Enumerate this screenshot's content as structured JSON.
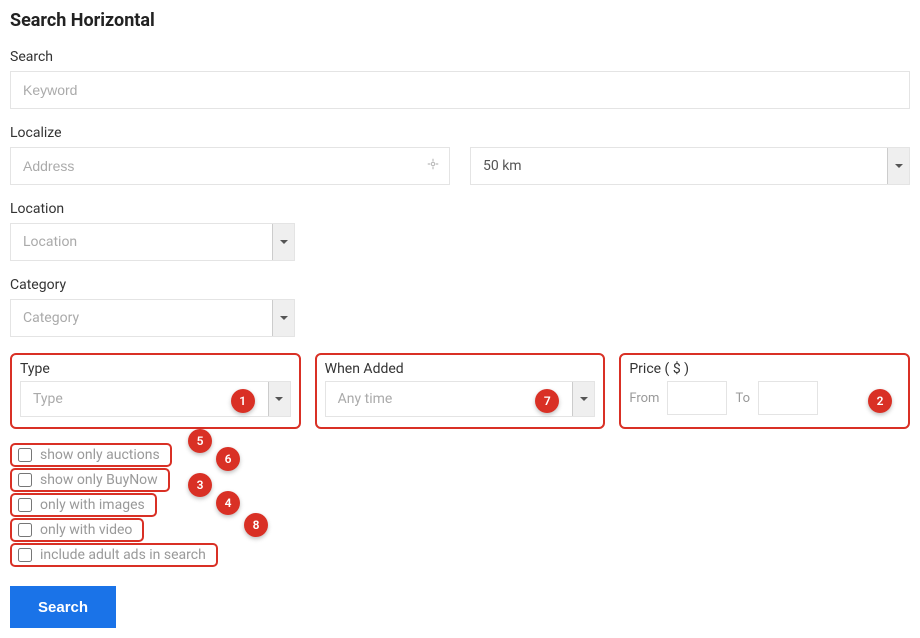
{
  "title": "Search Horizontal",
  "search": {
    "label": "Search",
    "placeholder": "Keyword"
  },
  "localize": {
    "label": "Localize",
    "address_placeholder": "Address",
    "distance_value": "50 km"
  },
  "location": {
    "label": "Location",
    "placeholder": "Location"
  },
  "category": {
    "label": "Category",
    "placeholder": "Category"
  },
  "type": {
    "label": "Type",
    "placeholder": "Type",
    "badge": "1"
  },
  "when_added": {
    "label": "When Added",
    "placeholder": "Any time",
    "badge": "7"
  },
  "price": {
    "label": "Price ( $ )",
    "from_label": "From",
    "to_label": "To",
    "badge": "2"
  },
  "checkboxes": {
    "auctions": {
      "label": "show only auctions",
      "badge": "5"
    },
    "buynow": {
      "label": "show only BuyNow",
      "badge": "6"
    },
    "images": {
      "label": "only with images",
      "badge": "3"
    },
    "video": {
      "label": "only with video",
      "badge": "4"
    },
    "adult": {
      "label": "include adult ads in search",
      "badge": "8"
    }
  },
  "search_button": "Search"
}
